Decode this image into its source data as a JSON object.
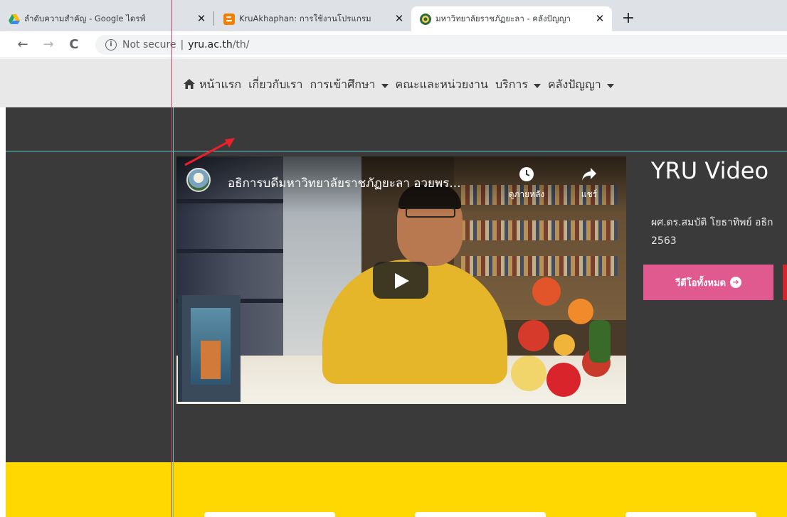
{
  "browser": {
    "tabs": [
      {
        "title": "ลำดับความสำคัญ - Google ไดรฟ์",
        "icon": "google-drive-icon",
        "active": false
      },
      {
        "title": "KruAkhaphan: การใช้งานโปรแกรม Fa",
        "icon": "blogger-icon",
        "active": false
      },
      {
        "title": "มหาวิทยาลัยราชภัฏยะลา - คลังปัญญา",
        "icon": "yru-site-icon",
        "active": true
      }
    ],
    "close_glyph": "✕",
    "new_tab_glyph": "+",
    "nav": {
      "back": "←",
      "forward": "→",
      "reload": "C"
    },
    "address": {
      "security": "Not secure",
      "separator": "|",
      "host": "yru.ac.th",
      "path": "/th/"
    }
  },
  "site_nav": {
    "items": [
      {
        "label": "หน้าแรก",
        "icon": "home-icon",
        "dropdown": false
      },
      {
        "label": "เกี่ยวกับเรา",
        "dropdown": false
      },
      {
        "label": "การเข้าศึกษา",
        "dropdown": true
      },
      {
        "label": "คณะและหน่วยงาน",
        "dropdown": false
      },
      {
        "label": "บริการ",
        "dropdown": true
      },
      {
        "label": "คลังปัญญา",
        "dropdown": true
      }
    ]
  },
  "video": {
    "title": "อธิการบดีมหาวิทยาลัยราชภัฏยะลา อวยพร...",
    "watch_later": "ดูภายหลัง",
    "share": "แชร์"
  },
  "panel": {
    "title": "YRU Video",
    "description_line1": "ผศ.ดร.สมบัติ โยธาทิพย์ อธิก",
    "description_line2": "2563",
    "all_videos_button": "วีดีโอทั้งหมด"
  },
  "colors": {
    "dark_section": "#3a3a3a",
    "pink_button": "#e05a8f",
    "yellow_band": "#fed800",
    "annotation_arrow": "#e8212b"
  }
}
